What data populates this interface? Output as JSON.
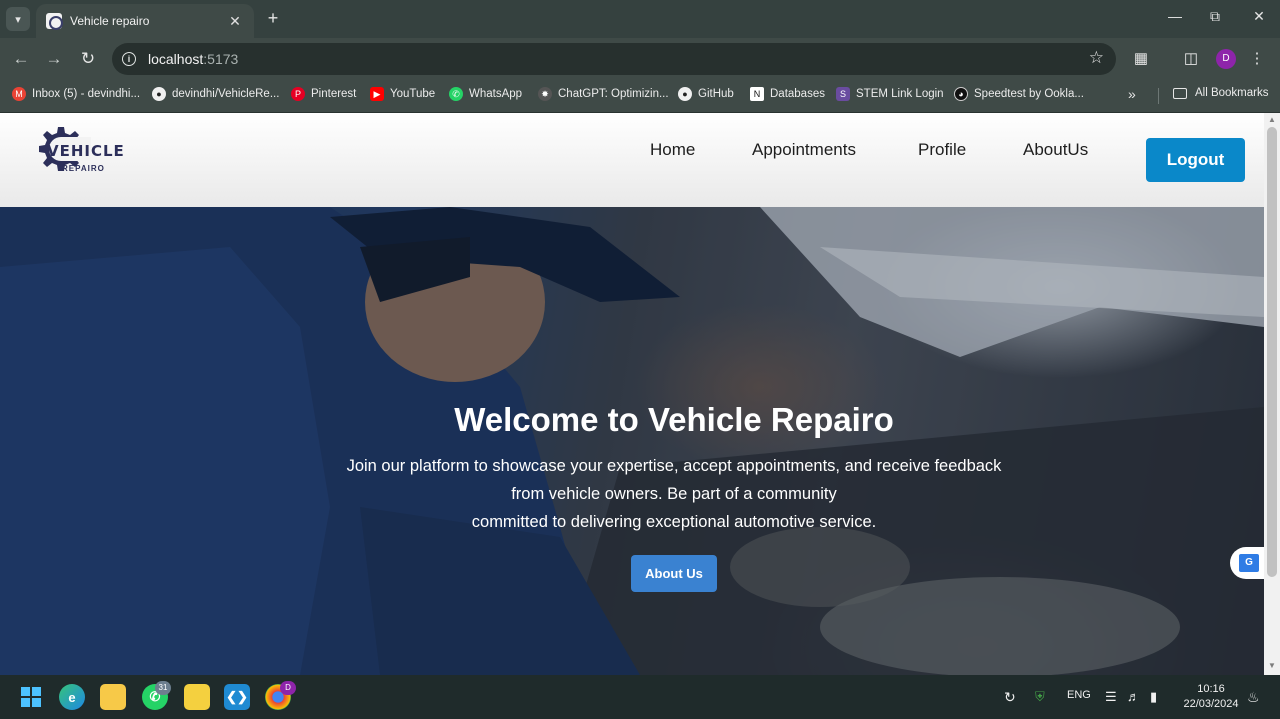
{
  "browser": {
    "tab_title": "Vehicle repairo",
    "url_host": "localhost",
    "url_port": ":5173",
    "profile_initial": "D",
    "bookmarks": [
      {
        "label": "Inbox (5) - devindhi...",
        "icon": "gmail-icon",
        "color": "#ea4335"
      },
      {
        "label": "devindhi/VehicleRe...",
        "icon": "github-icon",
        "color": "#222222"
      },
      {
        "label": "Pinterest",
        "icon": "pinterest-icon",
        "color": "#e60023"
      },
      {
        "label": "YouTube",
        "icon": "youtube-icon",
        "color": "#ff0000"
      },
      {
        "label": "WhatsApp",
        "icon": "whatsapp-icon",
        "color": "#25d366"
      },
      {
        "label": "ChatGPT: Optimizin...",
        "icon": "chatgpt-icon",
        "color": "#555555"
      },
      {
        "label": "GitHub",
        "icon": "github-icon",
        "color": "#222222"
      },
      {
        "label": "Databases",
        "icon": "notion-icon",
        "color": "#ffffff"
      },
      {
        "label": "STEM Link Login",
        "icon": "stemlink-icon",
        "color": "#6a4ca0"
      },
      {
        "label": "Speedtest by Ookla...",
        "icon": "speedtest-icon",
        "color": "#111111"
      }
    ],
    "all_bookmarks": "All Bookmarks"
  },
  "site": {
    "logo_text": "VEHICLE",
    "logo_sub": "REPAIRO",
    "nav": [
      "Home",
      "Appointments",
      "Profile",
      "AboutUs"
    ],
    "logout_label": "Logout"
  },
  "hero": {
    "title": "Welcome to Vehicle Repairo",
    "line1": "Join our platform to showcase your expertise, accept appointments, and receive feedback",
    "line2": "from vehicle owners. Be part of a community",
    "line3": "committed to delivering exceptional automotive service.",
    "button_label": "About Us"
  },
  "taskbar": {
    "whatsapp_badge": "31",
    "chrome_badge": "D",
    "language": "ENG",
    "time": "10:16",
    "date": "22/03/2024"
  },
  "colors": {
    "brand_blue": "#0a88c9",
    "hero_button": "#3a82d1",
    "logo_navy": "#2c2f5a"
  }
}
